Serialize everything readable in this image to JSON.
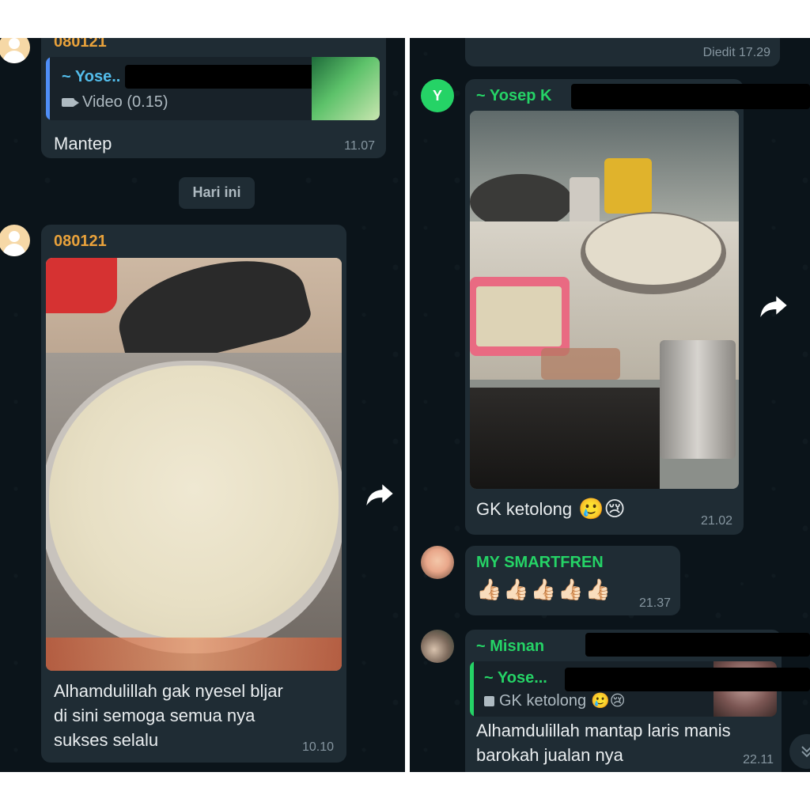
{
  "left_panel": {
    "msg_prev": {
      "sender": "080121",
      "quote_name": "~ Yose..",
      "quote_text": "Video (0.15)",
      "text": "Mantep",
      "time": "11.07"
    },
    "date_chip": "Hari ini",
    "msg_main": {
      "sender": "080121",
      "text": "Alhamdulillah gak nyesel bljar\ndi sini semoga semua nya\nsukses selalu",
      "time": "10.10"
    }
  },
  "right_panel": {
    "msg_top": {
      "edited": "Diedit 17.29"
    },
    "msg_yosep": {
      "avatar_letter": "Y",
      "sender": "~ Yosep K",
      "text": "GK ketolong",
      "emoji": "🥲😢",
      "time": "21.02"
    },
    "msg_smartfren": {
      "sender": "MY SMARTFREN",
      "text": "👍🏻👍🏻👍🏻👍🏻👍🏻",
      "time": "21.37"
    },
    "msg_misnan": {
      "sender": "~ Misnan",
      "quote_name": "~ Yose...",
      "quote_text": "GK ketolong",
      "quote_emoji": "🥲😢",
      "text": "Alhamdulillah mantap laris manis\nbarokah jualan nya",
      "time": "22.11"
    }
  },
  "colors": {
    "chat_bg": "#0b141a",
    "bubble": "#1f2c34",
    "sender_orange": "#e9a23b",
    "sender_green": "#25d366",
    "sender_blue": "#53bdeb",
    "quote_bar_blue": "#4f8ef7",
    "quote_bar_green": "#25d366",
    "time_gray": "#8696a0"
  }
}
